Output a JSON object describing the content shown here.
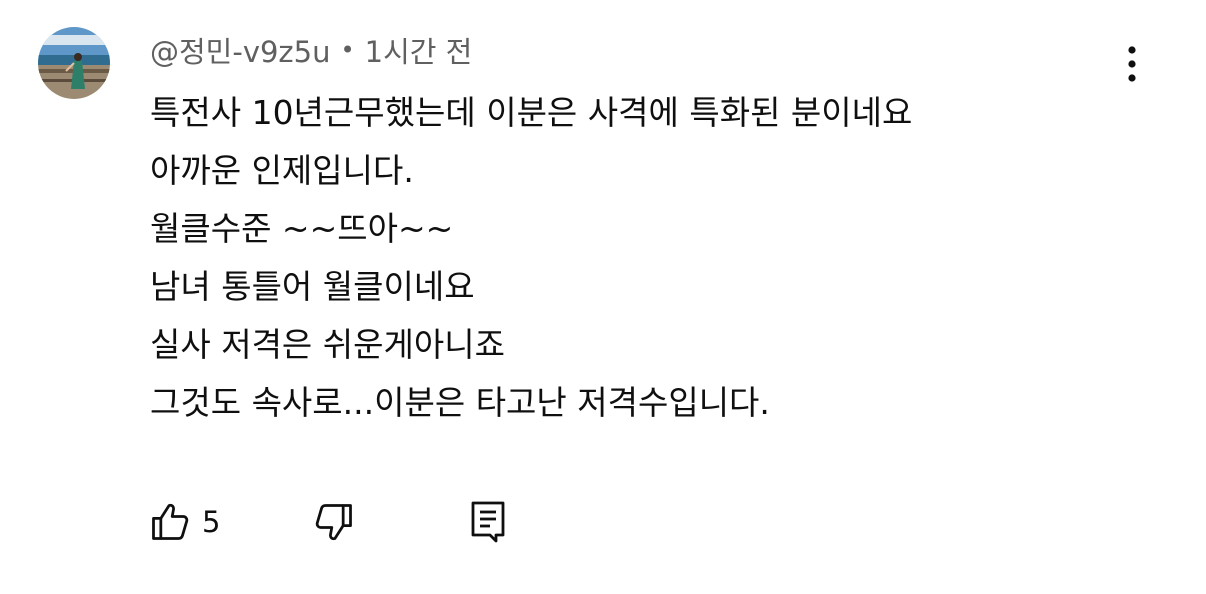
{
  "comment": {
    "author": "@정민-v9z5u",
    "separator": "•",
    "time": "1시간 전",
    "lines": [
      "특전사 10년근무했는데 이분은 사격에 특화된 분이네요",
      "아까운 인제입니다.",
      "월클수준 ~~뜨아~~",
      "남녀 통틀어 월클이네요",
      "실사 저격은 쉬운게아니죠",
      "그것도 속사로...이분은 타고난 저격수입니다."
    ],
    "like_count": "5"
  },
  "icons": {
    "like": "thumbs-up-icon",
    "dislike": "thumbs-down-icon",
    "reply": "comment-reply-icon",
    "more": "vertical-dots-icon"
  },
  "colors": {
    "text": "#0f0f0f",
    "secondary_text": "#606060"
  }
}
